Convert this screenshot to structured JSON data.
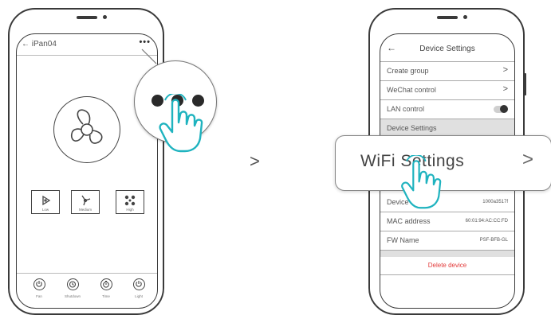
{
  "left_phone": {
    "title": "iPan04",
    "back_glyph": "←",
    "more_glyph": "•••",
    "modes": [
      {
        "label": "Low",
        "icon": "low-speed-icon"
      },
      {
        "label": "Medium",
        "icon": "medium-speed-icon"
      },
      {
        "label": "High",
        "icon": "high-speed-icon"
      }
    ],
    "bottom_buttons": [
      {
        "label": "Fan",
        "icon": "power-icon"
      },
      {
        "label": "Shutdown",
        "icon": "clock-icon"
      },
      {
        "label": "Time",
        "icon": "timer-icon"
      },
      {
        "label": "Light",
        "icon": "light-power-icon"
      }
    ]
  },
  "step_arrow": ">",
  "right_phone": {
    "title": "Device Settings",
    "back_glyph": "←",
    "rows": [
      {
        "label": "Create group",
        "chevron": ">"
      },
      {
        "label": "WeChat control",
        "chevron": ">"
      }
    ],
    "lan_control": {
      "label": "LAN control",
      "enabled": true
    },
    "section_header": "Device Settings",
    "info_rows": [
      {
        "label": "Device",
        "value": "1000a3517f"
      },
      {
        "label": "MAC address",
        "value": "60:01:94:AC:CC:FD"
      },
      {
        "label": "FW Name",
        "value": "PSF-BFB-GL"
      }
    ],
    "delete_label": "Delete device",
    "delete_color": "#e23a3a"
  },
  "zoom_card": {
    "label": "WiFi Settings",
    "chevron": ">"
  },
  "accent_color": "#1fb3bf"
}
